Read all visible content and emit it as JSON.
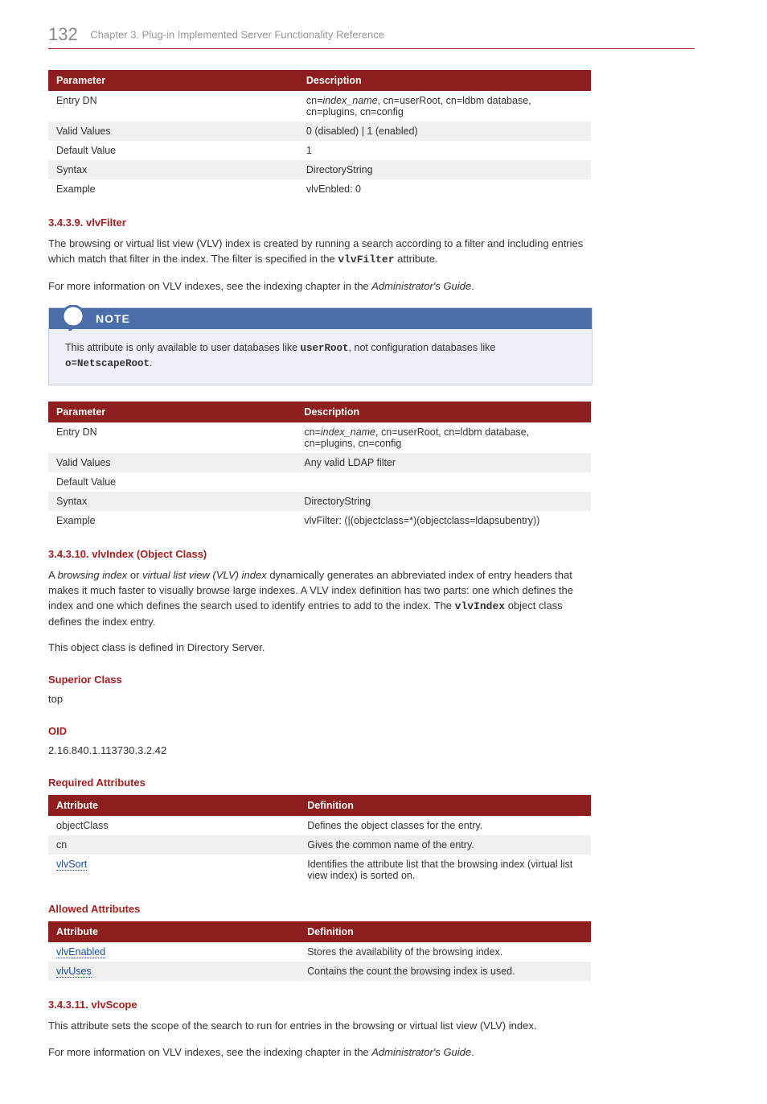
{
  "header": {
    "page_number": "132",
    "chapter_title": "Chapter 3. Plug-in Implemented Server Functionality Reference"
  },
  "table1": {
    "col1": "Parameter",
    "col2": "Description",
    "rows": [
      {
        "p": "Entry DN",
        "d_pre_italic": "cn=",
        "d_italic": "index_name",
        "d_post_italic": ", cn=userRoot, cn=ldbm database, cn=plugins, cn=config"
      },
      {
        "p": "Valid Values",
        "d": "0 (disabled) | 1 (enabled)"
      },
      {
        "p": "Default Value",
        "d": "1"
      },
      {
        "p": "Syntax",
        "d": "DirectoryString"
      },
      {
        "p": "Example",
        "d": "vlvEnbled: 0"
      }
    ]
  },
  "sec_filter": {
    "heading": "3.4.3.9. vlvFilter",
    "para1_a": "The browsing or virtual list view (VLV) index is created by running a search according to a filter and including entries which match that filter in the index. The filter is specified in the ",
    "para1_mono": "vlvFilter",
    "para1_b": " attribute.",
    "para2_a": "For more information on VLV indexes, see the indexing chapter in the ",
    "para2_em": "Administrator's Guide",
    "para2_b": "."
  },
  "note": {
    "title": "NOTE",
    "body_a": "This attribute is only available to user databases like ",
    "body_mono1": "userRoot",
    "body_b": ", not configuration databases like ",
    "body_mono2": "o=NetscapeRoot",
    "body_c": "."
  },
  "table2": {
    "col1": "Parameter",
    "col2": "Description",
    "rows": [
      {
        "p": "Entry DN",
        "d_pre_italic": "cn=",
        "d_italic": "index_name",
        "d_post_italic": ", cn=userRoot, cn=ldbm database, cn=plugins, cn=config"
      },
      {
        "p": "Valid Values",
        "d": "Any valid LDAP filter"
      },
      {
        "p": "Default Value",
        "d": ""
      },
      {
        "p": "Syntax",
        "d": "DirectoryString"
      },
      {
        "p": "Example",
        "d": "vlvFilter: (|(objectclass=*)(objectclass=ldapsubentry))"
      }
    ]
  },
  "sec_index": {
    "heading": "3.4.3.10. vlvIndex (Object Class)",
    "para1_a": "A ",
    "para1_em1": "browsing index",
    "para1_b": " or ",
    "para1_em2": "virtual list view (VLV) index",
    "para1_c": " dynamically generates an abbreviated index of entry headers that makes it much faster to visually browse large indexes. A VLV index definition has two parts: one which defines the index and one which defines the search used to identify entries to add to the index. The ",
    "para1_mono": "vlvIndex",
    "para1_d": " object class defines the index entry.",
    "para2": "This object class is defined in Directory Server."
  },
  "superior": {
    "heading": "Superior Class",
    "value": "top"
  },
  "oid": {
    "heading": "OID",
    "value": "2.16.840.1.113730.3.2.42"
  },
  "required": {
    "heading": "Required Attributes",
    "col1": "Attribute",
    "col2": "Definition",
    "rows": [
      {
        "a": "objectClass",
        "d": "Defines the object classes for the entry."
      },
      {
        "a": "cn",
        "d": "Gives the common name of the entry."
      },
      {
        "a_link": "vlvSort",
        "d": "Identifies the attribute list that the browsing index (virtual list view index) is sorted on."
      }
    ]
  },
  "allowed": {
    "heading": "Allowed Attributes",
    "col1": "Attribute",
    "col2": "Definition",
    "rows": [
      {
        "a_link": "vlvEnabled",
        "d": "Stores the availability of the browsing index."
      },
      {
        "a_link": "vlvUses",
        "d": "Contains the count the browsing index is used."
      }
    ]
  },
  "sec_scope": {
    "heading": "3.4.3.11. vlvScope",
    "para1": "This attribute sets the scope of the search to run for entries in the browsing or virtual list view (VLV) index.",
    "para2_a": "For more information on VLV indexes, see the indexing chapter in the ",
    "para2_em": "Administrator's Guide",
    "para2_b": "."
  }
}
